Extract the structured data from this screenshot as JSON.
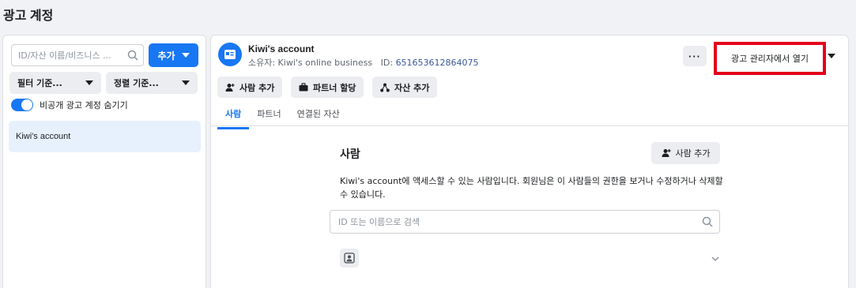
{
  "page": {
    "title": "광고 계정"
  },
  "left": {
    "search_placeholder": "ID/자산 이름/비즈니스 ...",
    "add_label": "추가",
    "filter_label": "필터 기준...",
    "sort_label": "정렬 기준...",
    "toggle_label": "비공개 광고 계정 숨기기",
    "accounts": [
      {
        "name": "Kiwi's account"
      }
    ]
  },
  "right": {
    "account_name": "Kiwi's account",
    "owner_prefix": "소유자: Kiwi's online business",
    "id_prefix": "ID:",
    "id_value": "651653612864075",
    "more_label": "···",
    "open_label": "광고 관리자에서 열기",
    "actions": {
      "add_person": "사람 추가",
      "assign_partner": "파트너 할당",
      "add_asset": "자산 추가"
    },
    "tabs": [
      {
        "label": "사람"
      },
      {
        "label": "파트너"
      },
      {
        "label": "연결된 자산"
      }
    ],
    "section": {
      "title": "사람",
      "add_person_label": "사람 추가",
      "description": "Kiwi's account에 액세스할 수 있는 사람입니다. 회원님은 이 사람들의 권한을 보거나 수정하거나 삭제할 수 있습니다.",
      "search_placeholder": "ID 또는 이름으로 검색"
    }
  },
  "colors": {
    "accent": "#1877f2",
    "highlight": "#e4001b",
    "selected_bg": "#e7f0fd"
  }
}
